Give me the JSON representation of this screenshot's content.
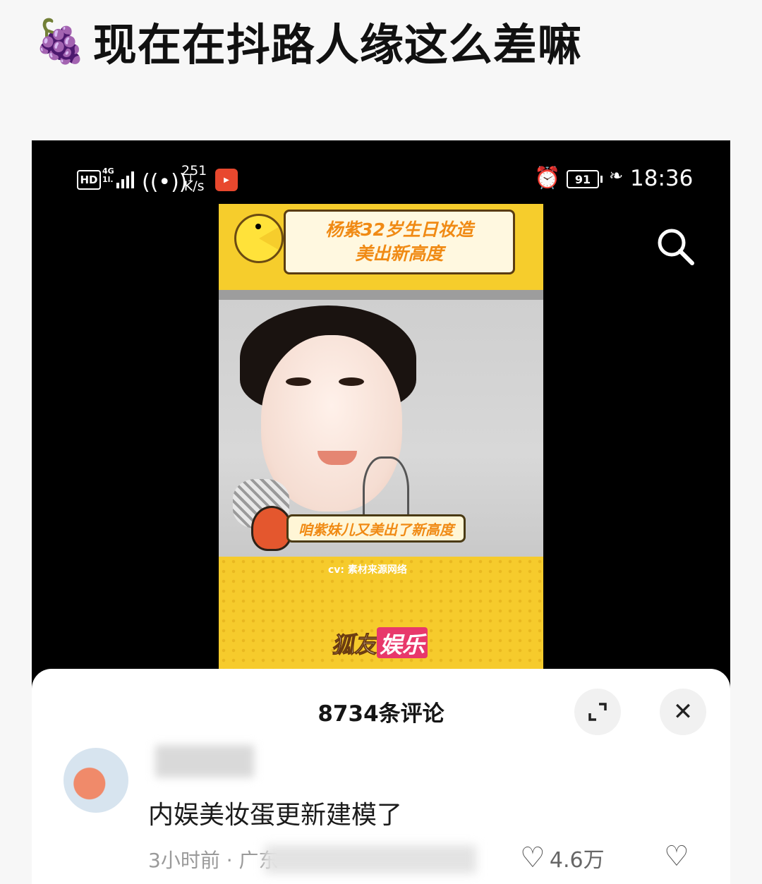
{
  "post": {
    "emoji": "🍇",
    "title": "现在在抖路人缘这么差嘛"
  },
  "status_bar": {
    "hd": "HD",
    "network": "4G",
    "network_sub": "1l.",
    "hotspot_count": "1",
    "speed_value": "251",
    "speed_unit": "K/s",
    "battery": "91",
    "time": "18:36"
  },
  "video": {
    "banner_line1": "杨紫32岁生日妆造",
    "banner_line2": "美出新高度",
    "caption": "咱紫妹儿又美出了新高度",
    "credit": "cv: 素材来源网络",
    "brand_part1": "狐友",
    "brand_part2": "娱乐"
  },
  "comments": {
    "count_label": "8734条评论",
    "close_symbol": "✕",
    "items": [
      {
        "text": "内娱美妆蛋更新建模了",
        "time": "3小时前",
        "separator": "·",
        "location": "广东",
        "likes": "4.6万"
      }
    ]
  },
  "icons": {
    "search": "search-icon",
    "expand": "expand-icon",
    "close": "close-icon",
    "like": "heart-icon",
    "dislike": "broken-heart-icon"
  },
  "colors": {
    "video_yellow": "#f6cd2c",
    "caption_orange": "#f08a14",
    "brand_pink": "#e8386b",
    "sheet_bg": "#ffffff"
  }
}
